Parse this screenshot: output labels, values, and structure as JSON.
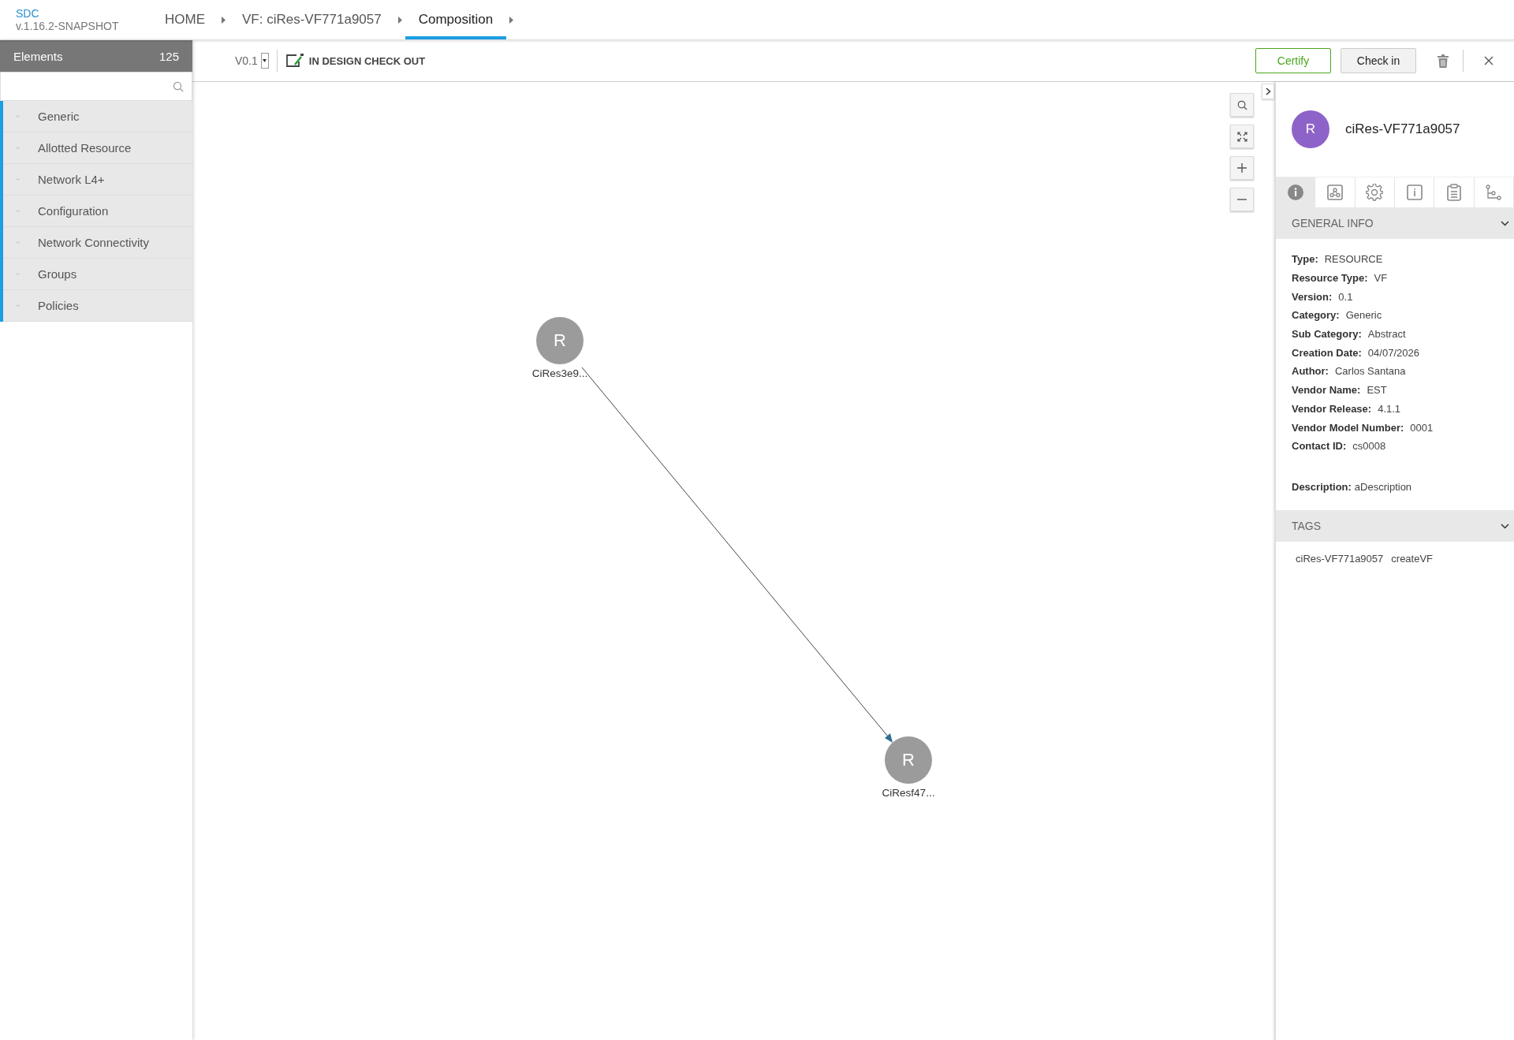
{
  "header": {
    "logo": "SDC",
    "version": "v.1.16.2-SNAPSHOT",
    "breadcrumbs": [
      {
        "label": "HOME",
        "selected": false
      },
      {
        "label": "VF: ciRes-VF771a9057",
        "selected": false
      },
      {
        "label": "Composition",
        "selected": true
      }
    ]
  },
  "sidebar": {
    "title": "Elements",
    "count": "125",
    "items": [
      {
        "label": "Generic"
      },
      {
        "label": "Allotted Resource"
      },
      {
        "label": "Network L4+"
      },
      {
        "label": "Configuration"
      },
      {
        "label": "Network Connectivity"
      },
      {
        "label": "Groups"
      },
      {
        "label": "Policies"
      }
    ]
  },
  "toolbar": {
    "version": "V0.1",
    "status": "IN DESIGN CHECK OUT",
    "buttons": [
      {
        "label": "Certify",
        "kind": "primary"
      },
      {
        "label": "Check in",
        "kind": "secondary"
      }
    ]
  },
  "canvas": {
    "nodes": [
      {
        "letter": "R",
        "label": "CiRes3e9..."
      },
      {
        "letter": "R",
        "label": "CiResf47..."
      }
    ]
  },
  "details": {
    "avatar": "R",
    "name": "ciRes-VF771a9057",
    "tabs": [
      {
        "kind": "info",
        "selected": true
      },
      {
        "kind": "composition",
        "selected": false
      },
      {
        "kind": "settings",
        "selected": false
      },
      {
        "kind": "info-box",
        "selected": false
      },
      {
        "kind": "clipboard",
        "selected": false
      },
      {
        "kind": "tree",
        "selected": false
      }
    ],
    "general_info": {
      "title": "GENERAL INFO",
      "fields": [
        {
          "label": "Type:",
          "value": "RESOURCE"
        },
        {
          "label": "Resource Type:",
          "value": "VF"
        },
        {
          "label": "Version:",
          "value": "0.1"
        },
        {
          "label": "Category:",
          "value": "Generic"
        },
        {
          "label": "Sub Category:",
          "value": "Abstract"
        },
        {
          "label": "Creation Date:",
          "value": "04/07/2026"
        },
        {
          "label": "Author:",
          "value": "Carlos Santana"
        },
        {
          "label": "Vendor Name:",
          "value": "EST"
        },
        {
          "label": "Vendor Release:",
          "value": "4.1.1"
        },
        {
          "label": "Vendor Model Number:",
          "value": "0001"
        },
        {
          "label": "Contact ID:",
          "value": "cs0008"
        }
      ],
      "description": {
        "label": "Description:",
        "value": "aDescription"
      }
    },
    "tags": {
      "title": "TAGS",
      "items": [
        "ciRes-VF771a9057",
        "createVF"
      ]
    }
  }
}
